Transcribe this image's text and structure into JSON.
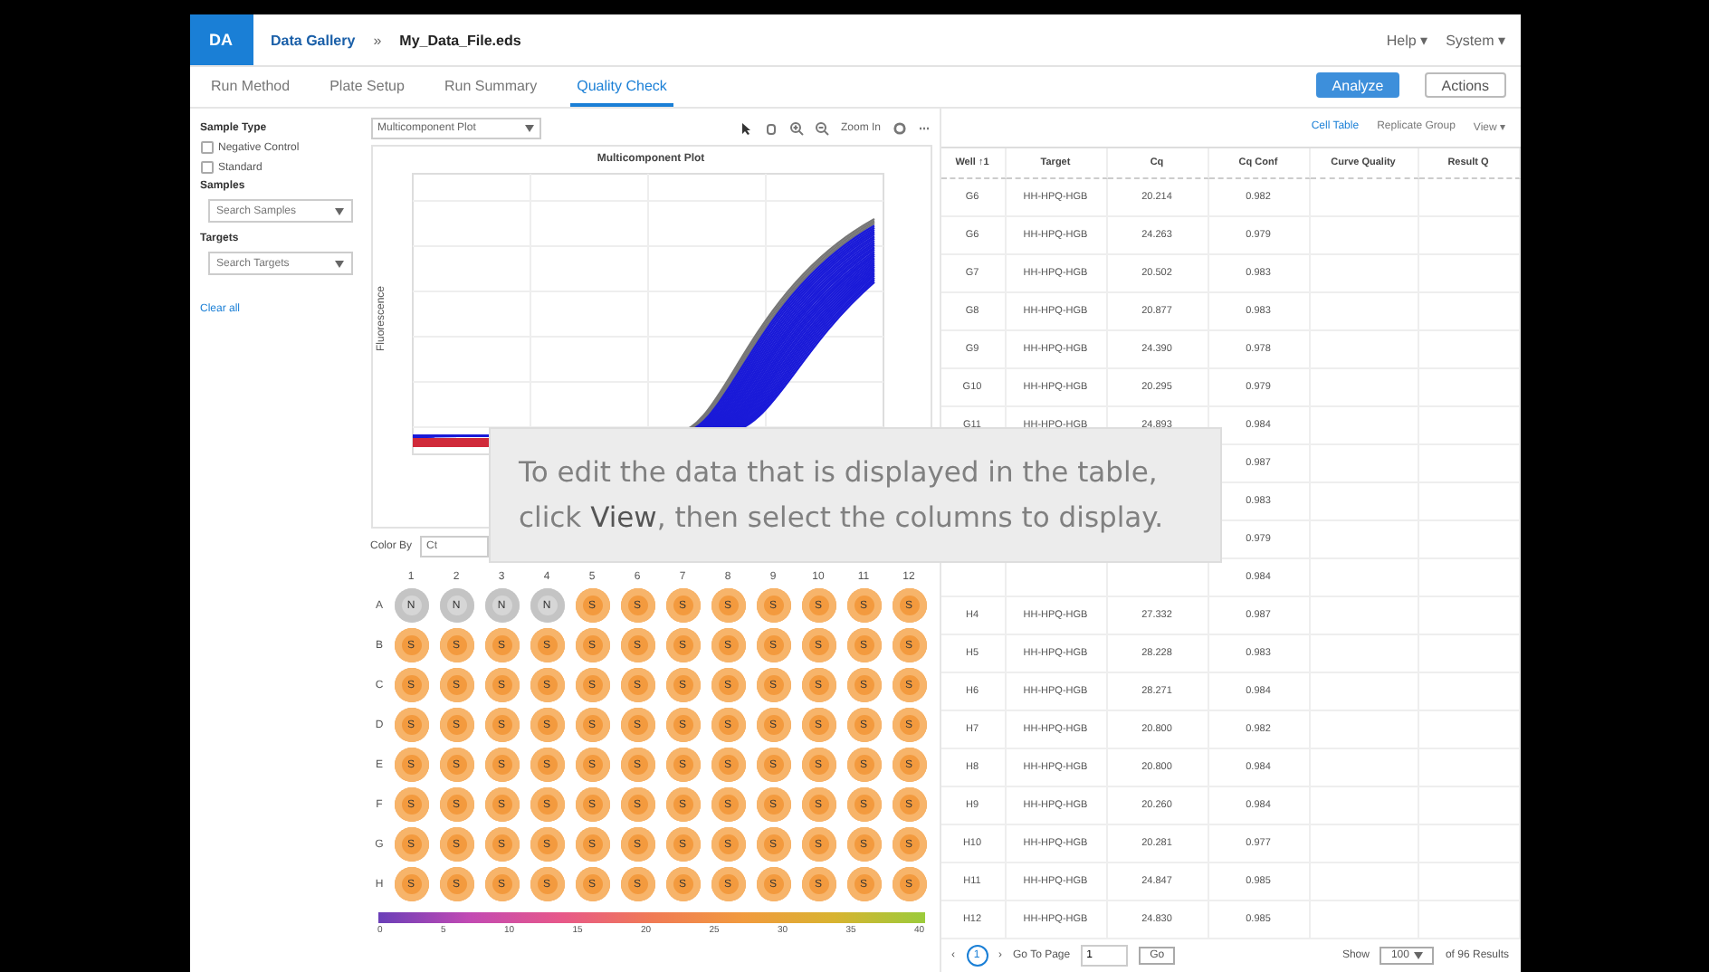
{
  "header": {
    "logo": "DA",
    "breadcrumb": "Data Gallery",
    "separator": "»",
    "file": "My_Data_File.eds",
    "help": "Help ▾",
    "system": "System ▾"
  },
  "tabs": [
    {
      "label": "Run Method",
      "selected": false
    },
    {
      "label": "Plate Setup",
      "selected": false
    },
    {
      "label": "Run Summary",
      "selected": false
    },
    {
      "label": "Quality Check",
      "selected": true
    }
  ],
  "actions": {
    "analyze": "Analyze",
    "actions": "Actions"
  },
  "sidebar": {
    "sample_type": "Sample Type",
    "options": [
      {
        "label": "Negative Control",
        "checked": false
      },
      {
        "label": "Standard",
        "checked": false
      }
    ],
    "samples": "Samples",
    "samples_placeholder": "Search Samples",
    "targets": "Targets",
    "targets_placeholder": "Search Targets",
    "clear": "Clear all"
  },
  "plot": {
    "selector": "Multicomponent Plot",
    "zoom": "Zoom In",
    "title": "Multicomponent Plot",
    "ylabel": "Fluorescence"
  },
  "plate": {
    "color_by": "Color By",
    "color_value": "Ct",
    "columns": [
      "1",
      "2",
      "3",
      "4",
      "5",
      "6",
      "7",
      "8",
      "9",
      "10",
      "11",
      "12"
    ],
    "rows": [
      {
        "label": "A",
        "wells": [
          {
            "kind": "ntc",
            "letter": "N"
          },
          {
            "kind": "ntc",
            "letter": "N"
          },
          {
            "kind": "ntc",
            "letter": "N"
          },
          {
            "kind": "ntc",
            "letter": "N"
          },
          {
            "kind": "unknown",
            "letter": "S"
          },
          {
            "kind": "unknown",
            "letter": "S"
          },
          {
            "kind": "unknown",
            "letter": "S"
          },
          {
            "kind": "unknown",
            "letter": "S"
          },
          {
            "kind": "unknown",
            "letter": "S"
          },
          {
            "kind": "unknown",
            "letter": "S"
          },
          {
            "kind": "unknown",
            "letter": "S"
          },
          {
            "kind": "unknown",
            "letter": "S"
          }
        ]
      },
      {
        "label": "B",
        "wells": [
          {
            "kind": "unknown",
            "letter": "S"
          },
          {
            "kind": "unknown",
            "letter": "S"
          },
          {
            "kind": "unknown",
            "letter": "S"
          },
          {
            "kind": "unknown",
            "letter": "S"
          },
          {
            "kind": "unknown",
            "letter": "S"
          },
          {
            "kind": "unknown",
            "letter": "S"
          },
          {
            "kind": "unknown",
            "letter": "S"
          },
          {
            "kind": "unknown",
            "letter": "S"
          },
          {
            "kind": "unknown",
            "letter": "S"
          },
          {
            "kind": "unknown",
            "letter": "S"
          },
          {
            "kind": "unknown",
            "letter": "S"
          },
          {
            "kind": "unknown",
            "letter": "S"
          }
        ]
      },
      {
        "label": "C",
        "wells": [
          {
            "kind": "unknown",
            "letter": "S"
          },
          {
            "kind": "unknown",
            "letter": "S"
          },
          {
            "kind": "unknown",
            "letter": "S"
          },
          {
            "kind": "unknown",
            "letter": "S"
          },
          {
            "kind": "unknown",
            "letter": "S"
          },
          {
            "kind": "unknown",
            "letter": "S"
          },
          {
            "kind": "unknown",
            "letter": "S"
          },
          {
            "kind": "unknown",
            "letter": "S"
          },
          {
            "kind": "unknown",
            "letter": "S"
          },
          {
            "kind": "unknown",
            "letter": "S"
          },
          {
            "kind": "unknown",
            "letter": "S"
          },
          {
            "kind": "unknown",
            "letter": "S"
          }
        ]
      },
      {
        "label": "D",
        "wells": [
          {
            "kind": "unknown",
            "letter": "S"
          },
          {
            "kind": "unknown",
            "letter": "S"
          },
          {
            "kind": "unknown",
            "letter": "S"
          },
          {
            "kind": "unknown",
            "letter": "S"
          },
          {
            "kind": "unknown",
            "letter": "S"
          },
          {
            "kind": "unknown",
            "letter": "S"
          },
          {
            "kind": "unknown",
            "letter": "S"
          },
          {
            "kind": "unknown",
            "letter": "S"
          },
          {
            "kind": "unknown",
            "letter": "S"
          },
          {
            "kind": "unknown",
            "letter": "S"
          },
          {
            "kind": "unknown",
            "letter": "S"
          },
          {
            "kind": "unknown",
            "letter": "S"
          }
        ]
      },
      {
        "label": "E",
        "wells": [
          {
            "kind": "unknown",
            "letter": "S"
          },
          {
            "kind": "unknown",
            "letter": "S"
          },
          {
            "kind": "unknown",
            "letter": "S"
          },
          {
            "kind": "unknown",
            "letter": "S"
          },
          {
            "kind": "unknown",
            "letter": "S"
          },
          {
            "kind": "unknown",
            "letter": "S"
          },
          {
            "kind": "unknown",
            "letter": "S"
          },
          {
            "kind": "unknown",
            "letter": "S"
          },
          {
            "kind": "unknown",
            "letter": "S"
          },
          {
            "kind": "unknown",
            "letter": "S"
          },
          {
            "kind": "unknown",
            "letter": "S"
          },
          {
            "kind": "unknown",
            "letter": "S"
          }
        ]
      },
      {
        "label": "F",
        "wells": [
          {
            "kind": "unknown",
            "letter": "S"
          },
          {
            "kind": "unknown",
            "letter": "S"
          },
          {
            "kind": "unknown",
            "letter": "S"
          },
          {
            "kind": "unknown",
            "letter": "S"
          },
          {
            "kind": "unknown",
            "letter": "S"
          },
          {
            "kind": "unknown",
            "letter": "S"
          },
          {
            "kind": "unknown",
            "letter": "S"
          },
          {
            "kind": "unknown",
            "letter": "S"
          },
          {
            "kind": "unknown",
            "letter": "S"
          },
          {
            "kind": "unknown",
            "letter": "S"
          },
          {
            "kind": "unknown",
            "letter": "S"
          },
          {
            "kind": "unknown",
            "letter": "S"
          }
        ]
      },
      {
        "label": "G",
        "wells": [
          {
            "kind": "unknown",
            "letter": "S"
          },
          {
            "kind": "unknown",
            "letter": "S"
          },
          {
            "kind": "unknown",
            "letter": "S"
          },
          {
            "kind": "unknown",
            "letter": "S"
          },
          {
            "kind": "unknown",
            "letter": "S"
          },
          {
            "kind": "unknown",
            "letter": "S"
          },
          {
            "kind": "unknown",
            "letter": "S"
          },
          {
            "kind": "unknown",
            "letter": "S"
          },
          {
            "kind": "unknown",
            "letter": "S"
          },
          {
            "kind": "unknown",
            "letter": "S"
          },
          {
            "kind": "unknown",
            "letter": "S"
          },
          {
            "kind": "unknown",
            "letter": "S"
          }
        ]
      },
      {
        "label": "H",
        "wells": [
          {
            "kind": "unknown",
            "letter": "S"
          },
          {
            "kind": "unknown",
            "letter": "S"
          },
          {
            "kind": "unknown",
            "letter": "S"
          },
          {
            "kind": "unknown",
            "letter": "S"
          },
          {
            "kind": "unknown",
            "letter": "S"
          },
          {
            "kind": "unknown",
            "letter": "S"
          },
          {
            "kind": "unknown",
            "letter": "S"
          },
          {
            "kind": "unknown",
            "letter": "S"
          },
          {
            "kind": "unknown",
            "letter": "S"
          },
          {
            "kind": "unknown",
            "letter": "S"
          },
          {
            "kind": "unknown",
            "letter": "S"
          },
          {
            "kind": "unknown",
            "letter": "S"
          }
        ]
      }
    ],
    "scale": [
      "0",
      "5",
      "10",
      "15",
      "20",
      "25",
      "30",
      "35",
      "40"
    ]
  },
  "table_tools": {
    "cell_table": "Cell Table",
    "replicate": "Replicate Group",
    "view": "View ▾"
  },
  "table": {
    "columns": [
      "Well ↑1",
      "Target",
      "Cq",
      "Cq Conf",
      "Curve Quality",
      "Result Q"
    ],
    "rows": [
      {
        "well": "G6",
        "target": "HH-HPQ-HGB",
        "cq": "20.214",
        "conf": "0.982"
      },
      {
        "well": "G6",
        "target": "HH-HPQ-HGB",
        "cq": "24.263",
        "conf": "0.979"
      },
      {
        "well": "G7",
        "target": "HH-HPQ-HGB",
        "cq": "20.502",
        "conf": "0.983"
      },
      {
        "well": "G8",
        "target": "HH-HPQ-HGB",
        "cq": "20.877",
        "conf": "0.983"
      },
      {
        "well": "G9",
        "target": "HH-HPQ-HGB",
        "cq": "24.390",
        "conf": "0.978"
      },
      {
        "well": "G10",
        "target": "HH-HPQ-HGB",
        "cq": "20.295",
        "conf": "0.979"
      },
      {
        "well": "G11",
        "target": "HH-HPQ-HGB",
        "cq": "24.893",
        "conf": "0.984"
      },
      {
        "conf": "0.987"
      },
      {
        "conf": "0.983"
      },
      {
        "conf": "0.979"
      },
      {
        "conf": "0.984"
      },
      {
        "well": "H4",
        "target": "HH-HPQ-HGB",
        "cq": "27.332",
        "conf": "0.987"
      },
      {
        "well": "H5",
        "target": "HH-HPQ-HGB",
        "cq": "28.228",
        "conf": "0.983"
      },
      {
        "well": "H6",
        "target": "HH-HPQ-HGB",
        "cq": "28.271",
        "conf": "0.984"
      },
      {
        "well": "H7",
        "target": "HH-HPQ-HGB",
        "cq": "20.800",
        "conf": "0.982"
      },
      {
        "well": "H8",
        "target": "HH-HPQ-HGB",
        "cq": "20.800",
        "conf": "0.984"
      },
      {
        "well": "H9",
        "target": "HH-HPQ-HGB",
        "cq": "20.260",
        "conf": "0.984"
      },
      {
        "well": "H10",
        "target": "HH-HPQ-HGB",
        "cq": "20.281",
        "conf": "0.977"
      },
      {
        "well": "H11",
        "target": "HH-HPQ-HGB",
        "cq": "24.847",
        "conf": "0.985"
      },
      {
        "well": "H12",
        "target": "HH-HPQ-HGB",
        "cq": "24.830",
        "conf": "0.985"
      }
    ]
  },
  "pagination": {
    "prev": "‹",
    "page": "1",
    "next": "›",
    "goto": "Go To Page",
    "page_input": "1",
    "go": "Go",
    "show": "Show",
    "per_page": "100",
    "results": "of 96 Results"
  },
  "tip": "To edit the data that is displayed in the table, click **View**, then select the columns to display."
}
